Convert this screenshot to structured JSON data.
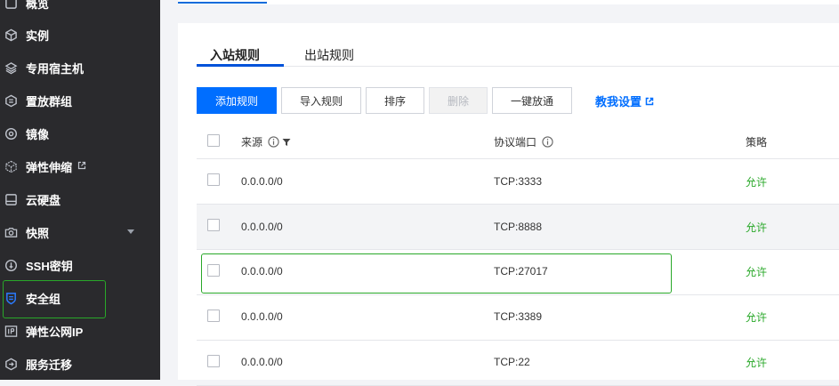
{
  "sidebar": {
    "items": [
      {
        "label": "概览",
        "icon": "overview-icon"
      },
      {
        "label": "实例",
        "icon": "cube-icon"
      },
      {
        "label": "专用宿主机",
        "icon": "layers-icon"
      },
      {
        "label": "置放群组",
        "icon": "placement-icon"
      },
      {
        "label": "镜像",
        "icon": "disc-icon"
      },
      {
        "label": "弹性伸缩",
        "icon": "scaling-icon",
        "external": true
      },
      {
        "label": "云硬盘",
        "icon": "disk-icon"
      },
      {
        "label": "快照",
        "icon": "camera-icon",
        "expandable": true
      },
      {
        "label": "SSH密钥",
        "icon": "key-icon"
      },
      {
        "label": "安全组",
        "icon": "shield-icon",
        "active": true
      },
      {
        "label": "弹性公网IP",
        "icon": "ip-icon"
      },
      {
        "label": "服务迁移",
        "icon": "migrate-icon"
      }
    ]
  },
  "tabs": [
    {
      "label": "入站规则",
      "active": true
    },
    {
      "label": "出站规则",
      "active": false
    }
  ],
  "toolbar": {
    "add_rule": "添加规则",
    "import_rule": "导入规则",
    "sort": "排序",
    "delete": "删除",
    "one_click_allow": "一键放通",
    "teach_me": "教我设置"
  },
  "table": {
    "headers": {
      "source": "来源",
      "protocol_port": "协议端口",
      "policy": "策略"
    },
    "rows": [
      {
        "source": "0.0.0.0/0",
        "protocol_port": "TCP:3333",
        "policy": "允许"
      },
      {
        "source": "0.0.0.0/0",
        "protocol_port": "TCP:8888",
        "policy": "允许"
      },
      {
        "source": "0.0.0.0/0",
        "protocol_port": "TCP:27017",
        "policy": "允许"
      },
      {
        "source": "0.0.0.0/0",
        "protocol_port": "TCP:3389",
        "policy": "允许"
      },
      {
        "source": "0.0.0.0/0",
        "protocol_port": "TCP:22",
        "policy": "允许"
      }
    ]
  },
  "colors": {
    "primary": "#006eff",
    "allow": "#29a829",
    "sidebar_bg": "#2a2a2d",
    "highlight": "#29a829"
  }
}
